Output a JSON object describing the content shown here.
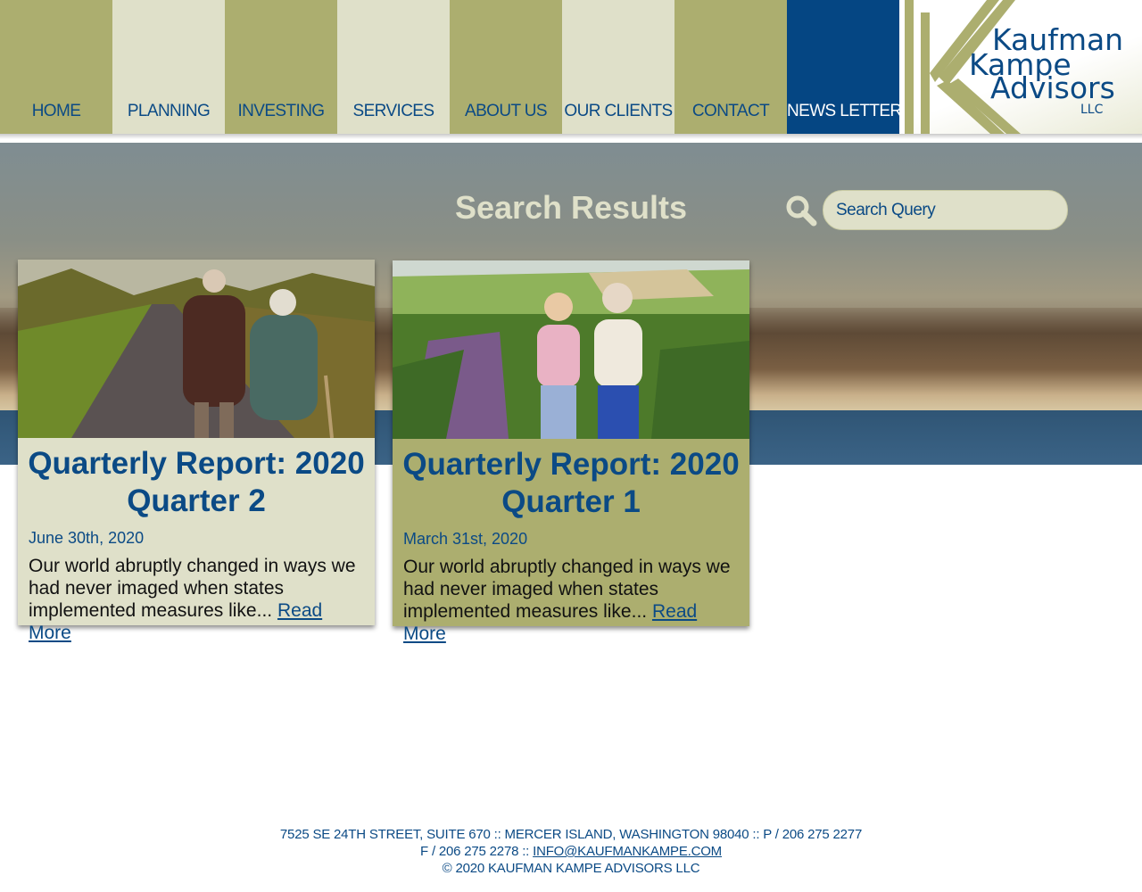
{
  "nav": {
    "items": [
      {
        "label": "HOME",
        "style": "olive"
      },
      {
        "label": "PLANNING",
        "style": "cream"
      },
      {
        "label": "INVESTING",
        "style": "olive"
      },
      {
        "label": "SERVICES",
        "style": "cream"
      },
      {
        "label": "ABOUT US",
        "style": "olive"
      },
      {
        "label": "OUR CLIENTS",
        "style": "cream"
      },
      {
        "label": "CONTACT",
        "style": "olive"
      },
      {
        "label": "NEWS LETTER",
        "style": "blue"
      }
    ]
  },
  "logo": {
    "line1": "Kaufman",
    "line2": "Kampe",
    "line3": "Advisors",
    "line4": "LLC"
  },
  "hero": {
    "title": "Search Results"
  },
  "search": {
    "placeholder": "Search Query"
  },
  "posts": [
    {
      "title": "Quarterly Report: 2020 Quarter 2",
      "date": "June 30th, 2020",
      "excerpt": "Our world abruptly changed in ways we had never imaged when states implemented measures like...",
      "read_more": "Read More"
    },
    {
      "title": "Quarterly Report: 2020 Quarter 1",
      "date": "March 31st, 2020",
      "excerpt": "Our world abruptly changed in ways we had never imaged when states implemented measures like...",
      "read_more": "Read More"
    }
  ],
  "footer": {
    "address": "7525 SE 24TH STREET, SUITE 670 :: MERCER ISLAND, WASHINGTON 98040 :: P / 206 275 2277",
    "fax": "F / 206 275 2278 :: ",
    "email": "INFO@KAUFMANKAMPE.COM",
    "copyright": "© 2020 KAUFMAN KAMPE ADVISORS LLC"
  },
  "colors": {
    "olive": "#acae6f",
    "cream": "#dfe0c9",
    "navy": "#054683",
    "text_blue": "#0b4a85"
  }
}
